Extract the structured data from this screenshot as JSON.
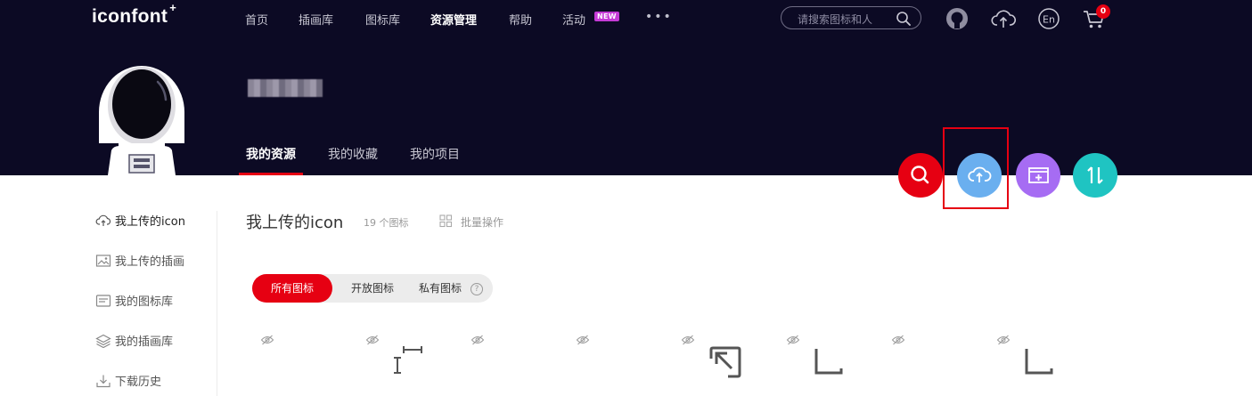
{
  "header": {
    "logo": "iconfont",
    "logo_plus": "+",
    "nav": [
      {
        "label": "首页",
        "active": false
      },
      {
        "label": "插画库",
        "active": false
      },
      {
        "label": "图标库",
        "active": false
      },
      {
        "label": "资源管理",
        "active": true
      },
      {
        "label": "帮助",
        "active": false
      },
      {
        "label": "活动",
        "active": false
      }
    ],
    "new_badge": "NEW",
    "more": "•••",
    "search_placeholder": "请搜索图标和人",
    "icons": [
      "search-icon",
      "github-icon",
      "upload-cloud-icon",
      "language-en-icon",
      "cart-icon"
    ],
    "language": "En",
    "cart_count": "0"
  },
  "profile": {
    "tabs": [
      {
        "label": "我的资源",
        "active": true
      },
      {
        "label": "我的收藏",
        "active": false
      },
      {
        "label": "我的项目",
        "active": false
      }
    ],
    "actions": [
      {
        "name": "search",
        "color": "#e60012",
        "icon": "search-icon"
      },
      {
        "name": "upload",
        "color": "#6aafef",
        "icon": "upload-cloud-icon"
      },
      {
        "name": "add-to-library",
        "color": "#a66cf3",
        "icon": "add-window-icon"
      },
      {
        "name": "sort",
        "color": "#1fc4c2",
        "icon": "up-down-arrows-icon"
      }
    ]
  },
  "sidebar": {
    "items": [
      {
        "label": "我上传的icon",
        "icon": "upload-cloud-icon",
        "active": true
      },
      {
        "label": "我上传的插画",
        "icon": "image-icon",
        "active": false
      },
      {
        "label": "我的图标库",
        "icon": "library-icon",
        "active": false
      },
      {
        "label": "我的插画库",
        "icon": "layers-icon",
        "active": false
      },
      {
        "label": "下载历史",
        "icon": "download-icon",
        "active": false
      }
    ]
  },
  "content": {
    "title": "我上传的icon",
    "count": "19 个图标",
    "batch": "批量操作",
    "filters": [
      {
        "label": "所有图标",
        "active": true
      },
      {
        "label": "开放图标",
        "active": false
      },
      {
        "label": "私有图标",
        "active": false
      }
    ],
    "help_mark": "?"
  },
  "colors": {
    "header_bg": "#0c0a24",
    "accent": "#e60012",
    "badge_new": "#c53bd6"
  }
}
